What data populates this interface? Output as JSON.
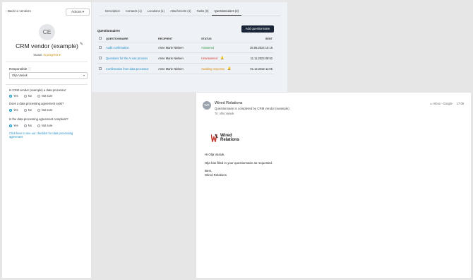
{
  "sidebar": {
    "back_label": "Back to vendors",
    "actions_label": "Actions",
    "avatar_initials": "CE",
    "company_name": "CRM vendor (example)",
    "status_label": "Status:",
    "status_value": "In progress",
    "responsible_label": "Responsible",
    "responsible_value": "Olja Vasiuk",
    "questions": [
      {
        "text": "Is CRM vendor (example) a data processor",
        "selected": "Yes"
      },
      {
        "text": "Does a data processing agreement exist?",
        "selected": "Yes"
      },
      {
        "text": "Is the data processing agreement compliant?",
        "selected": "Yes"
      }
    ],
    "radio_options": [
      "Yes",
      "No",
      "Not sure"
    ],
    "checklist_link": "Click here to see our checklist for data processing agreement"
  },
  "main": {
    "tabs": [
      "Description",
      "Contacts (1)",
      "Locations (1)",
      "Attachments (4)",
      "Tasks (0)",
      "Questionnaires (3)"
    ],
    "active_tab": 5,
    "section_title": "Questionnaires",
    "add_button": "Add questionnaire",
    "columns": [
      "QUESTIONNAIRE",
      "RECIPIENT",
      "STATUS",
      "SENT"
    ],
    "rows": [
      {
        "name": "Audit confirmation",
        "recipient": "Anne Marie Nielsen",
        "status": "Answered",
        "status_color": "#2e9b3f",
        "sent": "25.08.2022 10:19",
        "bell": false
      },
      {
        "name": "Questions for the AI use process",
        "recipient": "Anne Marie Nielsen",
        "status": "Unanswered",
        "status_color": "#d0342c",
        "sent": "11.11.2022 09:52",
        "bell": true
      },
      {
        "name": "Confirmation from data processor",
        "recipient": "Anne Marie Nielsen",
        "status": "Awaiting response",
        "status_color": "#d98a00",
        "sent": "01.12.2022 11:05",
        "bell": true
      }
    ]
  },
  "email": {
    "avatar": "WR",
    "sender": "Wired Relations",
    "subject": "Questionnaire is completed by CRM vendor (example)",
    "to_label": "To:",
    "to_value": "olha Vasiuk",
    "meta_folder": "Inbox - Google",
    "meta_time": "17:08",
    "logo_line1": "Wired",
    "logo_line2": "Relations",
    "greeting": "Hi Olja Vasiuk,",
    "body": "Olja has filled in your questionnaire as requested.",
    "signoff": "Best,",
    "signature": "Wired Relations"
  }
}
